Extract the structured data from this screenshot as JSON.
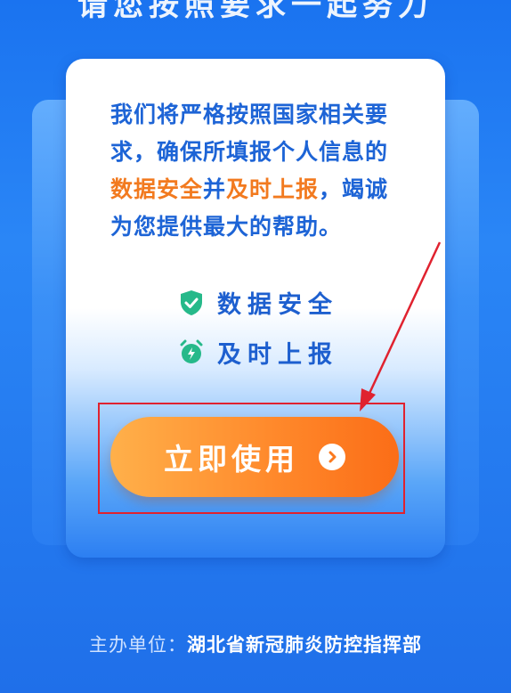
{
  "header": {
    "title": "请您按照要求一起努力"
  },
  "card": {
    "intro": {
      "line1": "我们将严格按照国家相关要",
      "line2": "求，确保所填报个人信息的",
      "hl1": "数据安全",
      "mid": "并",
      "hl2": "及时上报",
      "rest": "，竭诚",
      "line4": "为您提供最大的帮助。"
    },
    "features": [
      {
        "label": "数据安全",
        "icon": "shield-check-icon",
        "color": "#26b98a"
      },
      {
        "label": "及时上报",
        "icon": "alarm-clock-lightning-icon",
        "color": "#26b98a"
      }
    ],
    "cta": {
      "label": "立即使用",
      "icon": "chevron-right-circle-icon"
    }
  },
  "footer": {
    "prefix": "主办单位：",
    "organizer": "湖北省新冠肺炎防控指挥部"
  },
  "colors": {
    "primary": "#1d64d6",
    "accent": "#f27a1f",
    "cta_start": "#ffb04a",
    "cta_end": "#fb6d17",
    "annotation": "#e0222f"
  }
}
